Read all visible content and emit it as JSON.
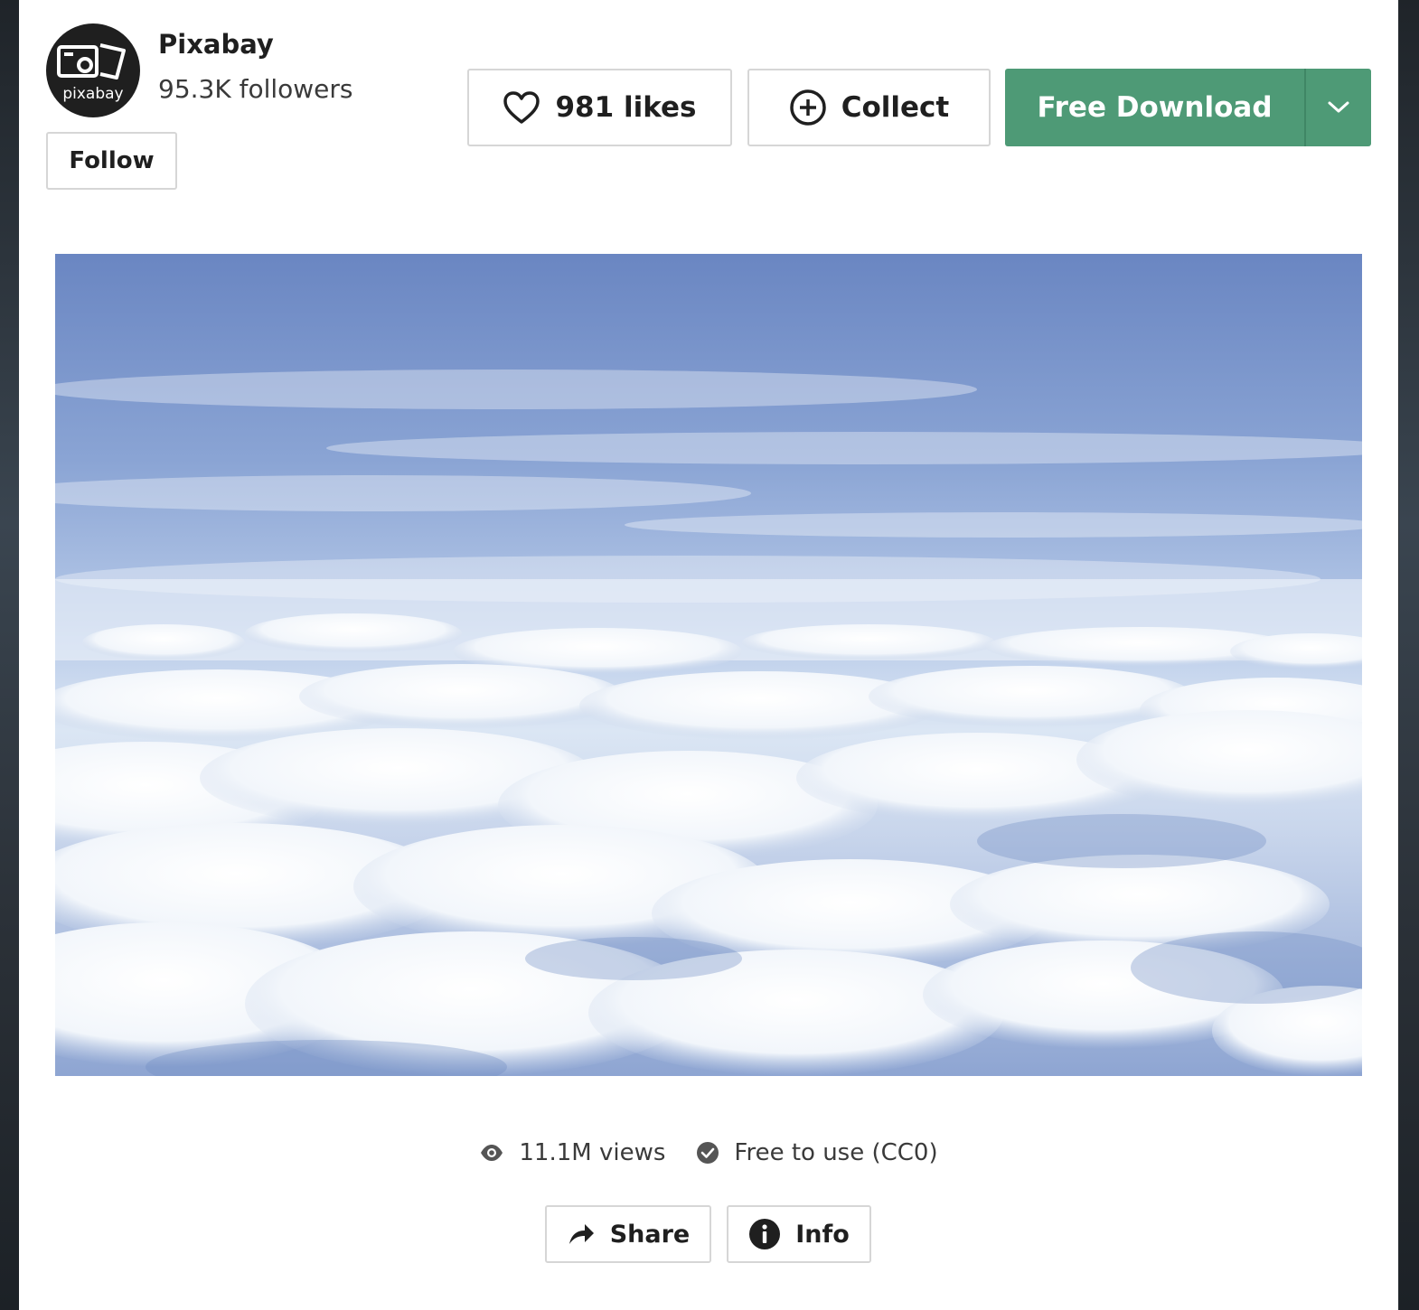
{
  "author": {
    "name": "Pixabay",
    "followers": "95.3K followers",
    "avatar_text": "pixabay",
    "follow_label": "Follow"
  },
  "actions": {
    "likes_label": "981 likes",
    "collect_label": "Collect",
    "download_label": "Free Download"
  },
  "stats": {
    "views": "11.1M views",
    "license": "Free to use (CC0)"
  },
  "footer": {
    "share_label": "Share",
    "info_label": "Info"
  },
  "colors": {
    "download_green": "#4e9a76",
    "sky_blue": "#6f8fc8",
    "text_dark": "#1f1f1f"
  },
  "icons": {
    "avatar": "camera-logo-icon",
    "likes": "heart-icon",
    "collect": "plus-circle-icon",
    "download_menu": "chevron-down-icon",
    "views": "eye-icon",
    "license": "check-circle-icon",
    "share": "share-arrow-icon",
    "info": "info-icon"
  }
}
